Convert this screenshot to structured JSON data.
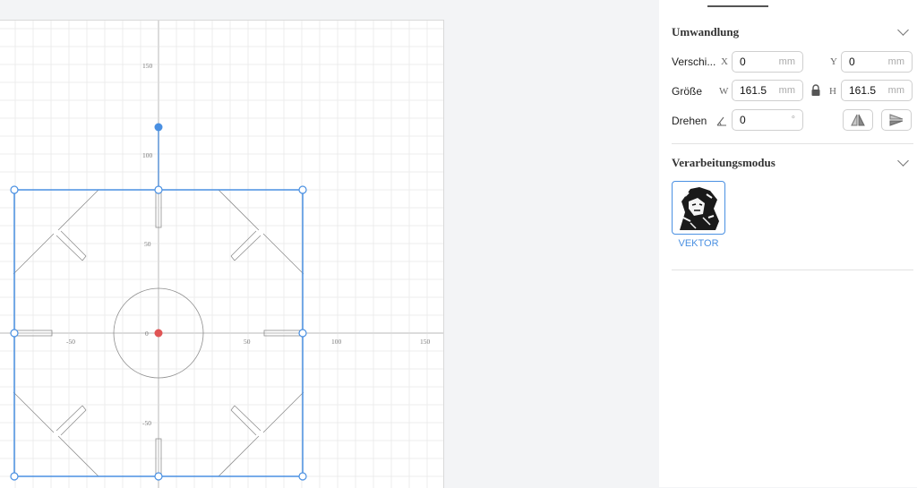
{
  "canvas": {
    "x_ticks": [
      "-50",
      "0",
      "50",
      "100",
      "150"
    ],
    "y_ticks": [
      "150",
      "100",
      "50",
      "-50"
    ],
    "selection_color": "#4a90e2",
    "origin_color": "#e05555"
  },
  "panel": {
    "transform": {
      "title": "Umwandlung",
      "offset_label": "Verschi...",
      "x_letter": "X",
      "x_value": "0",
      "x_unit": "mm",
      "y_letter": "Y",
      "y_value": "0",
      "y_unit": "mm",
      "size_label": "Größe",
      "w_letter": "W",
      "w_value": "161.5",
      "w_unit": "mm",
      "h_letter": "H",
      "h_value": "161.5",
      "h_unit": "mm",
      "rotate_label": "Drehen",
      "rotate_value": "0",
      "rotate_unit": "°"
    },
    "processing": {
      "title": "Verarbeitungsmodus",
      "mode_label": "VEKTOR"
    }
  },
  "icons": [
    "chevron-down-icon",
    "lock-icon",
    "angle-icon",
    "flip-horizontal-icon",
    "flip-vertical-icon"
  ]
}
